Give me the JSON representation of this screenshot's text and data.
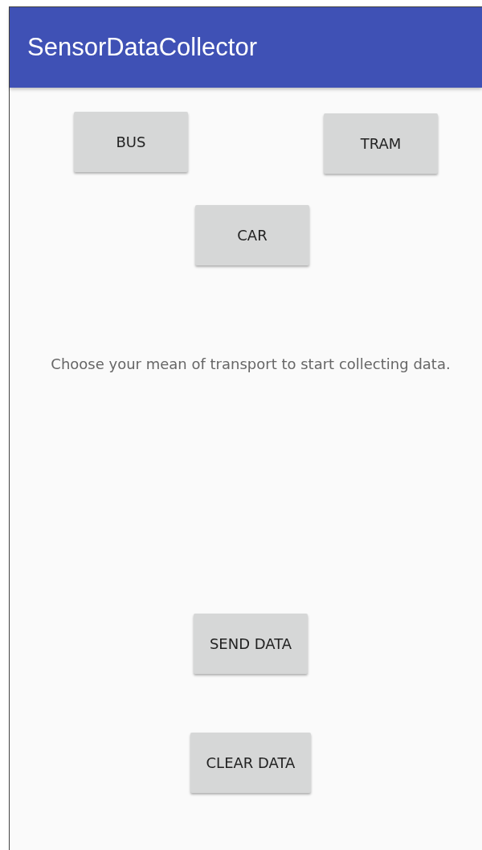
{
  "app_bar": {
    "title": "SensorDataCollector"
  },
  "transport_buttons": [
    {
      "label": "BUS"
    },
    {
      "label": "TRAM"
    },
    {
      "label": "CAR"
    }
  ],
  "message": "Choose your mean of transport to start collecting data.",
  "action_buttons": [
    {
      "label": "SEND DATA"
    },
    {
      "label": "CLEAR DATA"
    }
  ]
}
